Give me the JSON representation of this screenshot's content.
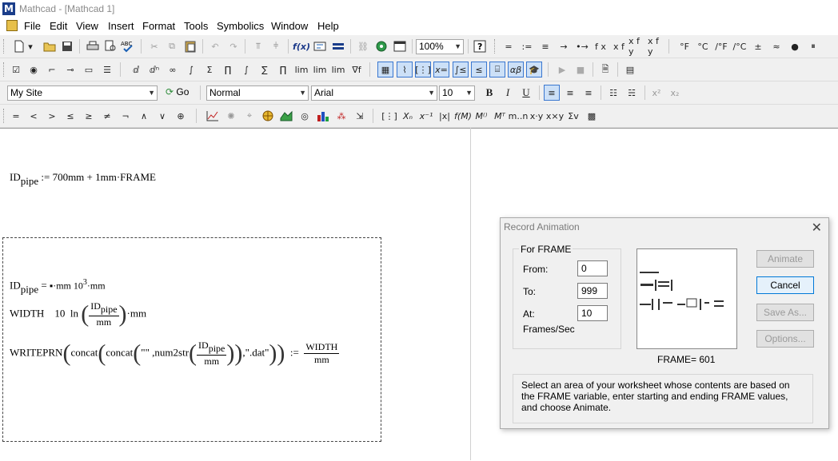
{
  "window": {
    "title": "Mathcad - [Mathcad 1]",
    "app_icon": "M"
  },
  "menu": [
    "File",
    "Edit",
    "View",
    "Insert",
    "Format",
    "Tools",
    "Symbolics",
    "Window",
    "Help"
  ],
  "toolbar_standard": {
    "zoom": "100%",
    "units_labels": [
      "=",
      ":=",
      "≡",
      "→",
      "•→",
      "f x",
      "x f",
      "x f y",
      "x f y",
      "°F",
      "°C",
      "/°F",
      "/°C",
      "±",
      "≈",
      "●",
      "⏸"
    ]
  },
  "toolbar_resources": {
    "site": "My Site",
    "go_label": "Go"
  },
  "toolbar_format": {
    "style": "Normal",
    "font": "Arial",
    "size": "10",
    "bold": "B",
    "italic": "I",
    "underline": "U"
  },
  "toolbar_math": {
    "boolean_ops": [
      "=",
      "<",
      ">",
      "≤",
      "≥",
      "≠",
      "¬",
      "∧",
      "∨",
      "⊕"
    ]
  },
  "worksheet": {
    "eq1": {
      "lhs": "ID",
      "lhs_sub": "pipe",
      "op": ":=",
      "rhs": "700mm + 1mm·FRAME"
    },
    "eq2": {
      "lhs": "ID",
      "lhs_sub": "pipe",
      "op": "=",
      "mantissa": "▪·mm 10",
      "exp": "3",
      "unit": "·mm"
    },
    "eq3": {
      "lhs": "WIDTH",
      "coef": "10",
      "fn": "ln",
      "num": "ID",
      "num_sub": "pipe",
      "den": "mm",
      "unit": "·mm"
    },
    "eq4": {
      "fn": "WRITEPRN",
      "concat1": "concat",
      "concat2": "concat",
      "str1": "\"\"",
      "num2str": ",num2str",
      "num": "ID",
      "num_sub": "pipe",
      "den": "mm",
      "ext": ",\".dat\"",
      "op": ":=",
      "rhs_num": "WIDTH",
      "rhs_den": "mm"
    }
  },
  "dialog": {
    "title": "Record Animation",
    "group_label": "For FRAME",
    "from_label": "From:",
    "from_value": "0",
    "to_label": "To:",
    "to_value": "999",
    "at_label": "At:",
    "at_value": "10",
    "rate_unit": "Frames/Sec",
    "frame_readout": "FRAME=  601",
    "buttons": {
      "animate": "Animate",
      "cancel": "Cancel",
      "save_as": "Save As...",
      "options": "Options..."
    },
    "hint": "Select an area of your worksheet whose contents are based on the FRAME variable, enter starting and ending FRAME values, and choose Animate."
  }
}
